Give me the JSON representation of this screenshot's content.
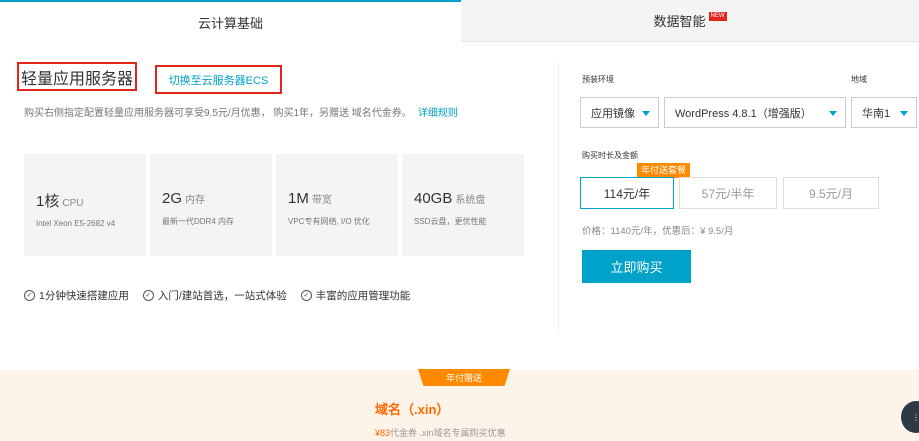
{
  "tabs": [
    {
      "label": "云计算基础",
      "active": true
    },
    {
      "label": "数据智能",
      "badge": "NEW",
      "active": false
    }
  ],
  "product": {
    "title": "轻量应用服务器",
    "switch_link": "切换至云服务器ECS",
    "description": "购买右侧指定配置轻量应用服务器可享受9.5元/月优惠， 购买1年，另赠送 域名代金券。",
    "rules_link": "详细规则"
  },
  "specs": [
    {
      "value": "1核",
      "unit": "CPU",
      "detail": "Intel Xeon E5-2682 v4"
    },
    {
      "value": "2G",
      "unit": "内存",
      "detail": "最新一代DDR4 内存"
    },
    {
      "value": "1M",
      "unit": "带宽",
      "detail": "VPC专有网络, I/O 优化"
    },
    {
      "value": "40GB",
      "unit": "系统盘",
      "detail": "SSD云盘，更优性能"
    }
  ],
  "features": [
    "1分钟快速搭建应用",
    "入门/建站首选，一站式体验",
    "丰富的应用管理功能"
  ],
  "config": {
    "env_label": "预装环境",
    "region_label": "地域",
    "image_type": "应用镜像",
    "image_version": "WordPress 4.8.1（增强版）",
    "region": "华南1",
    "duration_label": "购买时长及金额",
    "gift_tag": "年付送套餐",
    "durations": [
      {
        "label": "114元/年",
        "active": true
      },
      {
        "label": "57元/半年",
        "active": false
      },
      {
        "label": "9.5元/月",
        "active": false
      }
    ],
    "price_line": "价格：1140元/年，优惠后：¥ 9.5/月",
    "buy_button": "立即购买"
  },
  "promo": {
    "tag": "年付赠送",
    "title": "域名（.xin）",
    "amount": "¥83",
    "subtitle": "代金券 .xin域名专属购买优惠"
  },
  "colors": {
    "accent": "#00a2ca",
    "highlight": "#e1251b",
    "orange": "#ff8a00"
  }
}
